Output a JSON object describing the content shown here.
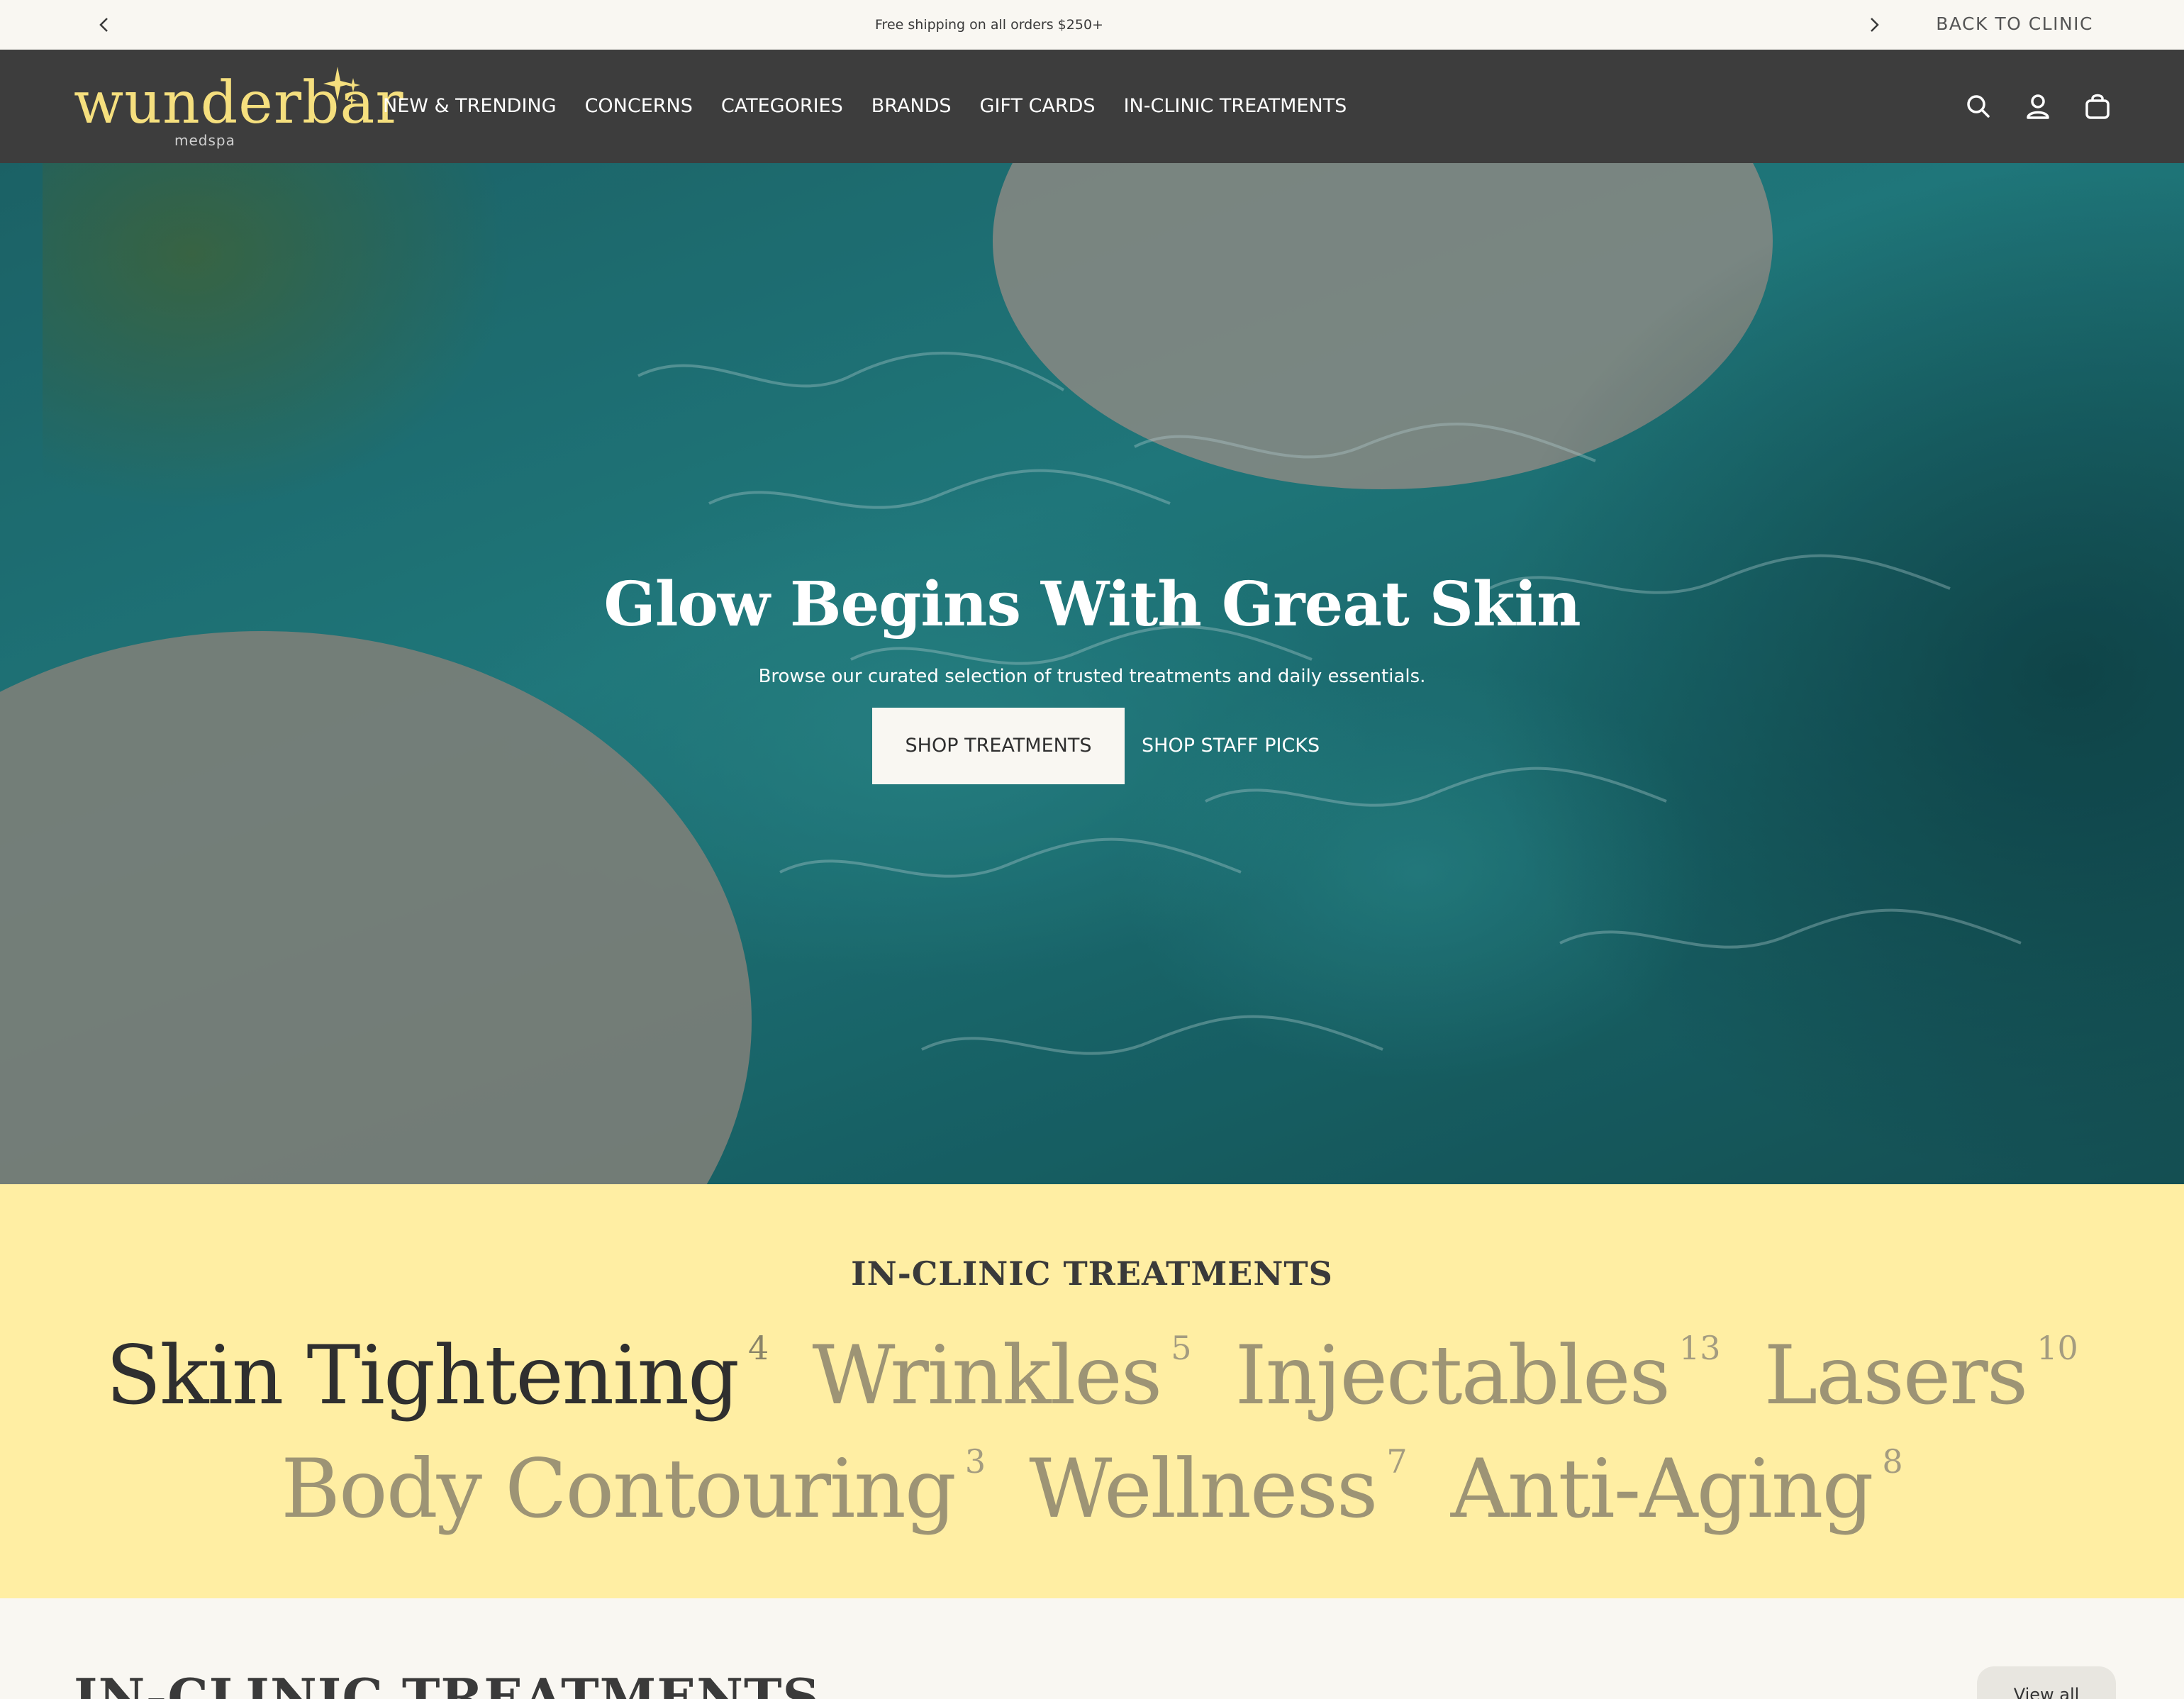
{
  "announcement": {
    "message": "Free shipping on all orders $250+",
    "prev_icon": "chevron-left-icon",
    "next_icon": "chevron-right-icon",
    "back_link": "BACK TO CLINIC"
  },
  "header": {
    "logo_word": "wunderbar",
    "logo_sub": "medspa",
    "brand_color": "#f5df7e",
    "background": "#3d3d3d",
    "nav": [
      "NEW & TRENDING",
      "CONCERNS",
      "CATEGORIES",
      "BRANDS",
      "GIFT CARDS",
      "IN-CLINIC TREATMENTS"
    ],
    "icons": [
      "search-icon",
      "account-icon",
      "cart-icon"
    ]
  },
  "hero": {
    "title": "Glow Begins With Great Skin",
    "subtitle": "Browse our curated selection of trusted treatments and daily essentials.",
    "primary_button": "SHOP TREATMENTS",
    "secondary_button": "SHOP STAFF PICKS"
  },
  "treatments": {
    "title": "IN-CLINIC TREATMENTS",
    "background": "#ffeea3",
    "rows": [
      [
        {
          "name": "Skin Tightening",
          "count": "4",
          "active": true
        },
        {
          "name": "Wrinkles",
          "count": "5",
          "active": false
        },
        {
          "name": "Injectables",
          "count": "13",
          "active": false
        },
        {
          "name": "Lasers",
          "count": "10",
          "active": false
        }
      ],
      [
        {
          "name": "Body Contouring",
          "count": "3",
          "active": false
        },
        {
          "name": "Wellness",
          "count": "7",
          "active": false
        },
        {
          "name": "Anti-Aging",
          "count": "8",
          "active": false
        }
      ]
    ]
  },
  "bottom": {
    "title": "IN-CLINIC TREATMENTS",
    "button": "View all"
  }
}
